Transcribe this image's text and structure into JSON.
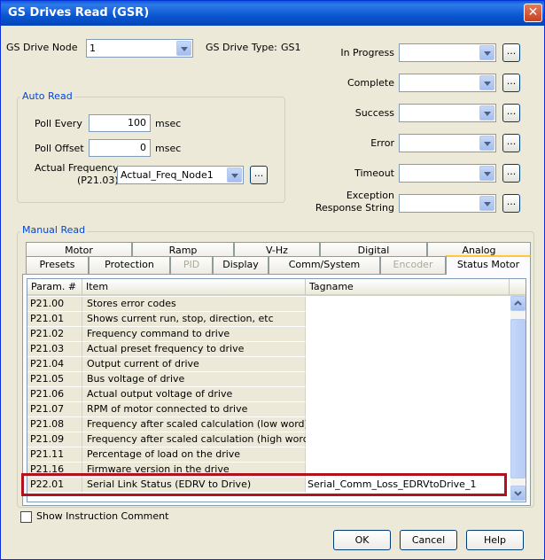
{
  "window": {
    "title": "GS Drives Read (GSR)",
    "close_glyph": "✕"
  },
  "top": {
    "drive_node_label": "GS Drive Node",
    "drive_node_value": "1",
    "drive_type_label": "GS Drive Type:",
    "drive_type_value": "GS1"
  },
  "status_fields": {
    "in_progress": "In Progress",
    "complete": "Complete",
    "success": "Success",
    "error": "Error",
    "timeout": "Timeout",
    "exception_line1": "Exception",
    "exception_line2": "Response String",
    "browse_glyph": "..."
  },
  "auto_read": {
    "title": "Auto Read",
    "poll_every_label": "Poll Every",
    "poll_every_value": "100",
    "poll_offset_label": "Poll Offset",
    "poll_offset_value": "0",
    "unit": "msec",
    "actual_freq_label_line1": "Actual Frequency",
    "actual_freq_label_line2": "(P21.03)",
    "actual_freq_value": "Actual_Freq_Node1"
  },
  "manual_read": {
    "title": "Manual Read",
    "tabs_row1": [
      "Motor",
      "Ramp",
      "V-Hz",
      "Digital",
      "Analog"
    ],
    "tabs_row2": [
      "Presets",
      "Protection",
      "PID",
      "Display",
      "Comm/System",
      "Encoder",
      "Status Motor"
    ],
    "columns": [
      "Param. #",
      "Item",
      "Tagname"
    ],
    "rows": [
      {
        "param": "P21.00",
        "item": "Stores error codes",
        "tag": ""
      },
      {
        "param": "P21.01",
        "item": "Shows current run, stop, direction, etc",
        "tag": ""
      },
      {
        "param": "P21.02",
        "item": "Frequency command to drive",
        "tag": ""
      },
      {
        "param": "P21.03",
        "item": "Actual preset frequency to drive",
        "tag": ""
      },
      {
        "param": "P21.04",
        "item": "Output current of drive",
        "tag": ""
      },
      {
        "param": "P21.05",
        "item": "Bus voltage of drive",
        "tag": ""
      },
      {
        "param": "P21.06",
        "item": "Actual output voltage of drive",
        "tag": ""
      },
      {
        "param": "P21.07",
        "item": "RPM of motor connected to drive",
        "tag": ""
      },
      {
        "param": "P21.08",
        "item": "Frequency after scaled calculation (low word)",
        "tag": ""
      },
      {
        "param": "P21.09",
        "item": "Frequency after scaled calculation (high word)",
        "tag": ""
      },
      {
        "param": "P21.11",
        "item": "Percentage of load on the drive",
        "tag": ""
      },
      {
        "param": "P21.16",
        "item": "Firmware version in the drive",
        "tag": ""
      },
      {
        "param": "P22.01",
        "item": "Serial Link Status (EDRV to Drive)",
        "tag": "Serial_Comm_Loss_EDRVtoDrive_1"
      }
    ]
  },
  "bottom": {
    "show_comment_label": "Show Instruction Comment",
    "ok": "OK",
    "cancel": "Cancel",
    "help": "Help"
  }
}
